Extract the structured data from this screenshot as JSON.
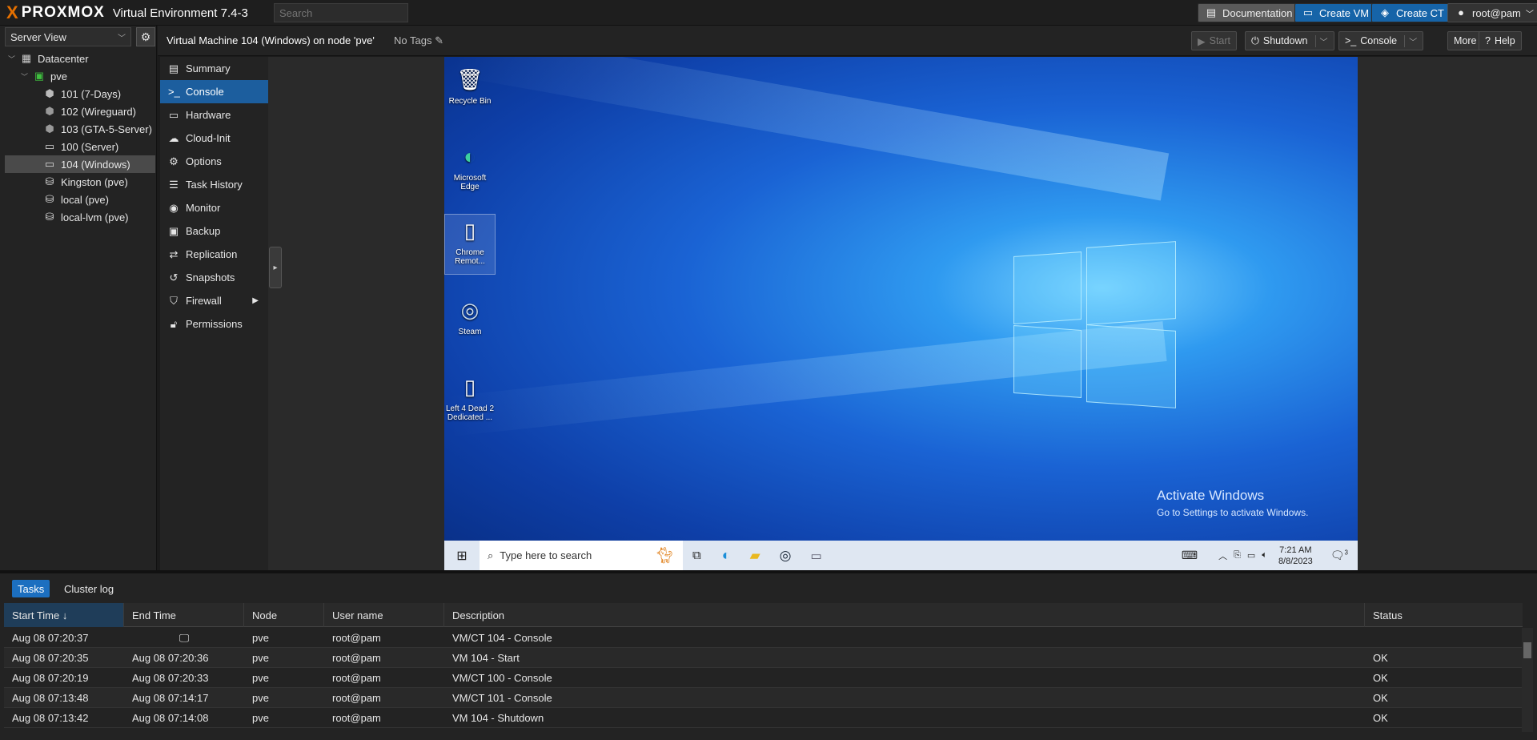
{
  "topbar": {
    "logo_x": "X",
    "logo_word": "PROXMOX",
    "version": "Virtual Environment 7.4-3",
    "search_placeholder": "Search",
    "documentation": "Documentation",
    "create_vm": "Create VM",
    "create_ct": "Create CT",
    "user": "root@pam"
  },
  "tree": {
    "view": "Server View",
    "nodes": [
      {
        "label": "Datacenter"
      },
      {
        "label": "pve"
      },
      {
        "label": "101 (7-Days)"
      },
      {
        "label": "102 (Wireguard)"
      },
      {
        "label": "103 (GTA-5-Server)"
      },
      {
        "label": "100 (Server)"
      },
      {
        "label": "104 (Windows)"
      },
      {
        "label": "Kingston (pve)"
      },
      {
        "label": "local (pve)"
      },
      {
        "label": "local-lvm (pve)"
      }
    ]
  },
  "vm_header": {
    "title": "Virtual Machine 104 (Windows) on node 'pve'",
    "tags": "No Tags",
    "start": "Start",
    "shutdown": "Shutdown",
    "console": "Console",
    "more": "More",
    "help": "Help"
  },
  "vm_menu": [
    {
      "label": "Summary"
    },
    {
      "label": "Console"
    },
    {
      "label": "Hardware"
    },
    {
      "label": "Cloud-Init"
    },
    {
      "label": "Options"
    },
    {
      "label": "Task History"
    },
    {
      "label": "Monitor"
    },
    {
      "label": "Backup"
    },
    {
      "label": "Replication"
    },
    {
      "label": "Snapshots"
    },
    {
      "label": "Firewall"
    },
    {
      "label": "Permissions"
    }
  ],
  "desktop": {
    "icons": [
      {
        "label": "Recycle Bin"
      },
      {
        "label": "Microsoft Edge"
      },
      {
        "label": "Chrome Remot..."
      },
      {
        "label": "Steam"
      },
      {
        "label": "Left 4 Dead 2 Dedicated ..."
      }
    ],
    "activate_title": "Activate Windows",
    "activate_sub": "Go to Settings to activate Windows.",
    "taskbar_search": "Type here to search",
    "time": "7:21 AM",
    "date": "8/8/2023",
    "notif_count": "3"
  },
  "tasks": {
    "tabs": [
      "Tasks",
      "Cluster log"
    ],
    "columns": [
      "Start Time",
      "End Time",
      "Node",
      "User name",
      "Description",
      "Status"
    ],
    "sort_arrow": "↓",
    "rows": [
      {
        "start": "Aug 08 07:20:37",
        "end": "",
        "node": "pve",
        "user": "root@pam",
        "desc": "VM/CT 104 - Console",
        "status": ""
      },
      {
        "start": "Aug 08 07:20:35",
        "end": "Aug 08 07:20:36",
        "node": "pve",
        "user": "root@pam",
        "desc": "VM 104 - Start",
        "status": "OK"
      },
      {
        "start": "Aug 08 07:20:19",
        "end": "Aug 08 07:20:33",
        "node": "pve",
        "user": "root@pam",
        "desc": "VM/CT 100 - Console",
        "status": "OK"
      },
      {
        "start": "Aug 08 07:13:48",
        "end": "Aug 08 07:14:17",
        "node": "pve",
        "user": "root@pam",
        "desc": "VM/CT 101 - Console",
        "status": "OK"
      },
      {
        "start": "Aug 08 07:13:42",
        "end": "Aug 08 07:14:08",
        "node": "pve",
        "user": "root@pam",
        "desc": "VM 104 - Shutdown",
        "status": "OK"
      }
    ]
  },
  "colors": {
    "accent": "#1c6fc0",
    "logo_orange": "#e57000"
  }
}
